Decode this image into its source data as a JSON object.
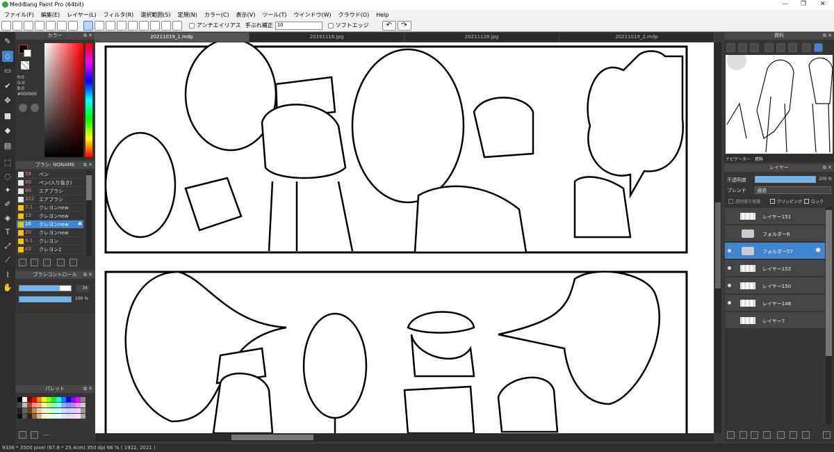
{
  "app": {
    "title": "MediBang Paint Pro (64bit)"
  },
  "menu": [
    "ファイル(F)",
    "編集(E)",
    "レイヤー(L)",
    "フィルタ(R)",
    "選択範囲(S)",
    "定規(N)",
    "カラー(C)",
    "表示(V)",
    "ツール(T)",
    "ウインドウ(W)",
    "クラウド(O)",
    "Help"
  ],
  "toolbar": {
    "antialias_label": "アンチエイリアス",
    "stabilizer_label": "手ぶれ補正",
    "stabilizer_value": "10",
    "soft_edge_label": "ソフトエッジ"
  },
  "doc_tabs": [
    "20211019_1.mdp",
    "20191116.jpg",
    "20211128.jpg",
    "20211019_2.mdp"
  ],
  "color_panel": {
    "title": "カラー",
    "r": "R:0",
    "g": "G:0",
    "b": "B:0",
    "hex": "#000000"
  },
  "brush_panel": {
    "title": "ブラシ: NONAME",
    "items": [
      {
        "size": "58",
        "name": "ペン",
        "color": "#e8e8e8"
      },
      {
        "size": "80",
        "name": "ペン(入り抜き)",
        "color": "#e8e8e8"
      },
      {
        "size": "80",
        "name": "エアブラシ",
        "color": "#e8e8e8"
      },
      {
        "size": "322",
        "name": "エアブラシ",
        "color": "#e8e8e8"
      },
      {
        "size": "7.1",
        "name": "クレヨンnew",
        "color": "#f2c400"
      },
      {
        "size": "13",
        "name": "クレヨンnew",
        "color": "#f2c400"
      },
      {
        "size": "16",
        "name": "クレヨンnew",
        "color": "#f2c400"
      },
      {
        "size": "20",
        "name": "クレヨンnew",
        "color": "#f2c400"
      },
      {
        "size": "9.1",
        "name": "クレヨン",
        "color": "#f2c400"
      },
      {
        "size": "43",
        "name": "クレヨン2",
        "color": "#f2c400"
      }
    ]
  },
  "brush_control": {
    "title": "ブラシコントロール",
    "size": "34",
    "opacity": "100 %",
    "size_fraction": 0.78,
    "opacity_fraction": 1.0
  },
  "palette": {
    "title": "パレット",
    "footer": "----"
  },
  "material": {
    "title": "資料",
    "tabs": [
      "ナビゲーター",
      "資料"
    ]
  },
  "layer_panel": {
    "title": "レイヤー",
    "opacity_label": "不透明度",
    "opacity_value": "100 %",
    "blend_label": "ブレンド",
    "blend_value": "通過",
    "protect_label": "透明度を保護",
    "clipping_label": "クリッピング",
    "lock_label": "ロック",
    "layers": [
      {
        "name": "レイヤー151",
        "type": "layer",
        "visible": false
      },
      {
        "name": "フォルダー6",
        "type": "folder",
        "visible": false
      },
      {
        "name": "フォルダー57",
        "type": "folder",
        "visible": true,
        "selected": true
      },
      {
        "name": "レイヤー152",
        "type": "layer",
        "visible": true
      },
      {
        "name": "レイヤー150",
        "type": "layer",
        "visible": true
      },
      {
        "name": "レイヤー148",
        "type": "layer",
        "visible": true
      },
      {
        "name": "レイヤー7",
        "type": "layer",
        "visible": false
      }
    ]
  },
  "status": {
    "text": "9336 * 3500 pixel   (67.8 * 25.4cm)   350 dpi   66 %   ( 1922, 2021 )"
  },
  "colors": {
    "accent": "#3f86d0",
    "panel": "#353535",
    "header": "#474747"
  }
}
